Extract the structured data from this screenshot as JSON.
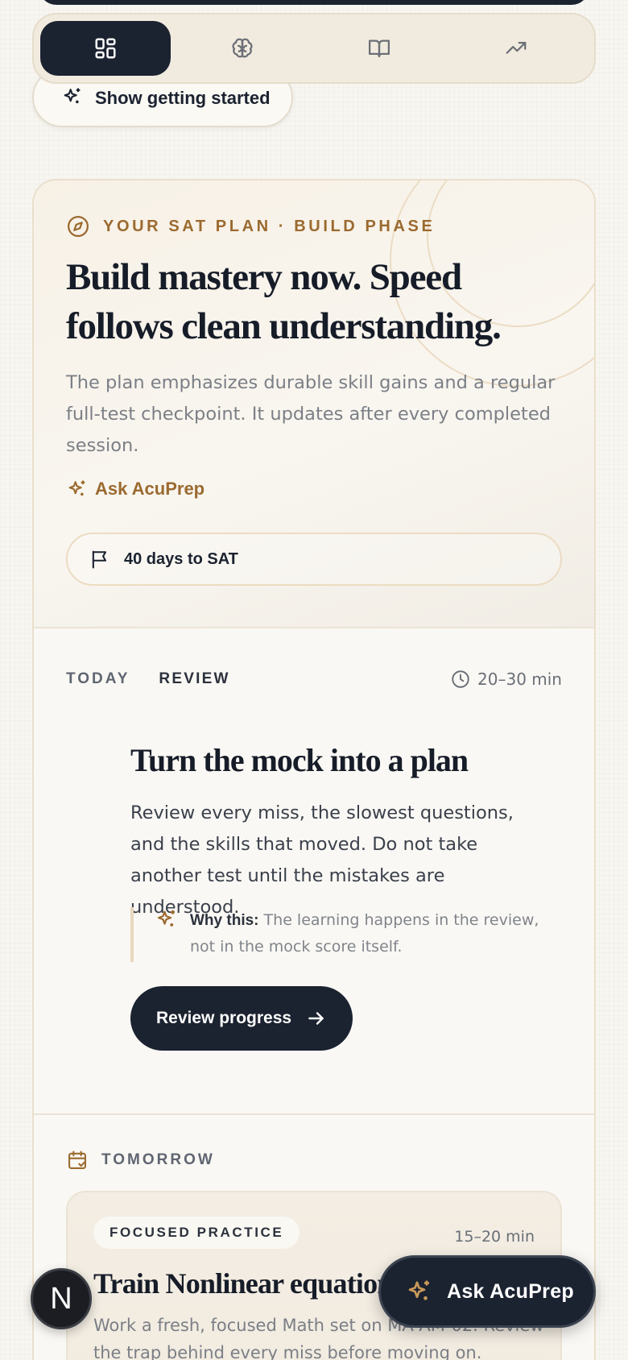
{
  "nav": {
    "tabs": [
      {
        "name": "dashboard",
        "icon": "grid-icon",
        "active": true
      },
      {
        "name": "brain",
        "icon": "brain-icon",
        "active": false
      },
      {
        "name": "book",
        "icon": "book-open-icon",
        "active": false
      },
      {
        "name": "progress",
        "icon": "trending-up-icon",
        "active": false
      }
    ]
  },
  "getting_started": {
    "label": "Show getting started",
    "icon": "sparkle-icon"
  },
  "plan": {
    "eyebrow": "YOUR SAT PLAN · BUILD PHASE",
    "title": "Build mastery now. Speed follows clean understanding.",
    "description": "The plan emphasizes durable skill gains and a regular full-test checkpoint. It updates after every completed session.",
    "ask_link": "Ask AcuPrep",
    "countdown": "40 days to SAT"
  },
  "today": {
    "label": "TODAY",
    "type": "REVIEW",
    "duration": "20–30 min",
    "title": "Turn the mock into a plan",
    "description": "Review every miss, the slowest questions, and the skills that moved. Do not take another test until the mistakes are understood.",
    "why_label": "Why this:",
    "why_text": "The learning happens in the review, not in the mock score itself.",
    "button": "Review progress"
  },
  "tomorrow": {
    "label": "TOMORROW",
    "tag": "FOCUSED PRACTICE",
    "duration": "15–20 min",
    "title": "Train Nonlinear equations",
    "description": "Work a fresh, focused Math set on MA-AM-02. Review the trap behind every miss before moving on."
  },
  "fab": {
    "avatar_letter": "N",
    "ask_label": "Ask AcuPrep"
  },
  "colors": {
    "ink": "#1b2230",
    "accent_gold": "#9b6a2f",
    "page_bg": "#f8f6f1",
    "card_bg": "#faf8f4"
  }
}
